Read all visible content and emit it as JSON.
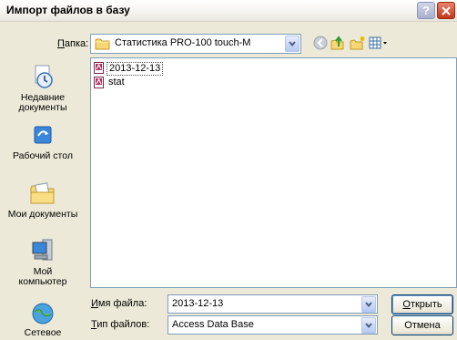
{
  "window": {
    "title": "Импорт файлов в базу",
    "help_symbol": "?"
  },
  "lookin": {
    "label": "Папка:",
    "label_hotkey": "П",
    "label_rest": "апка:",
    "value": "Статистика PRO-100 touch-M"
  },
  "places": [
    {
      "label": "Недавние документы",
      "icon": "recent-documents-icon"
    },
    {
      "label": "Рабочий стол",
      "icon": "desktop-icon"
    },
    {
      "label": "Мои документы",
      "icon": "my-documents-icon"
    },
    {
      "label": "Мой компьютер",
      "icon": "my-computer-icon"
    },
    {
      "label": "Сетевое",
      "icon": "network-icon"
    }
  ],
  "files": [
    {
      "name": "2013-12-13",
      "icon": "access-file-icon",
      "selected": true
    },
    {
      "name": "stat",
      "icon": "access-file-icon",
      "selected": false
    }
  ],
  "filename": {
    "label_hotkey": "И",
    "label_rest": "мя файла:",
    "value": "2013-12-13"
  },
  "filetype": {
    "label_hotkey": "Т",
    "label_rest": "ип файлов:",
    "value": "Access Data Base"
  },
  "buttons": {
    "open_hotkey": "О",
    "open_rest": "ткрыть",
    "cancel": "Отмена"
  },
  "colors": {
    "dialog_bg": "#ece9d8",
    "field_border": "#7f9db9",
    "button_border": "#003c74",
    "close_red": "#c1361b"
  }
}
